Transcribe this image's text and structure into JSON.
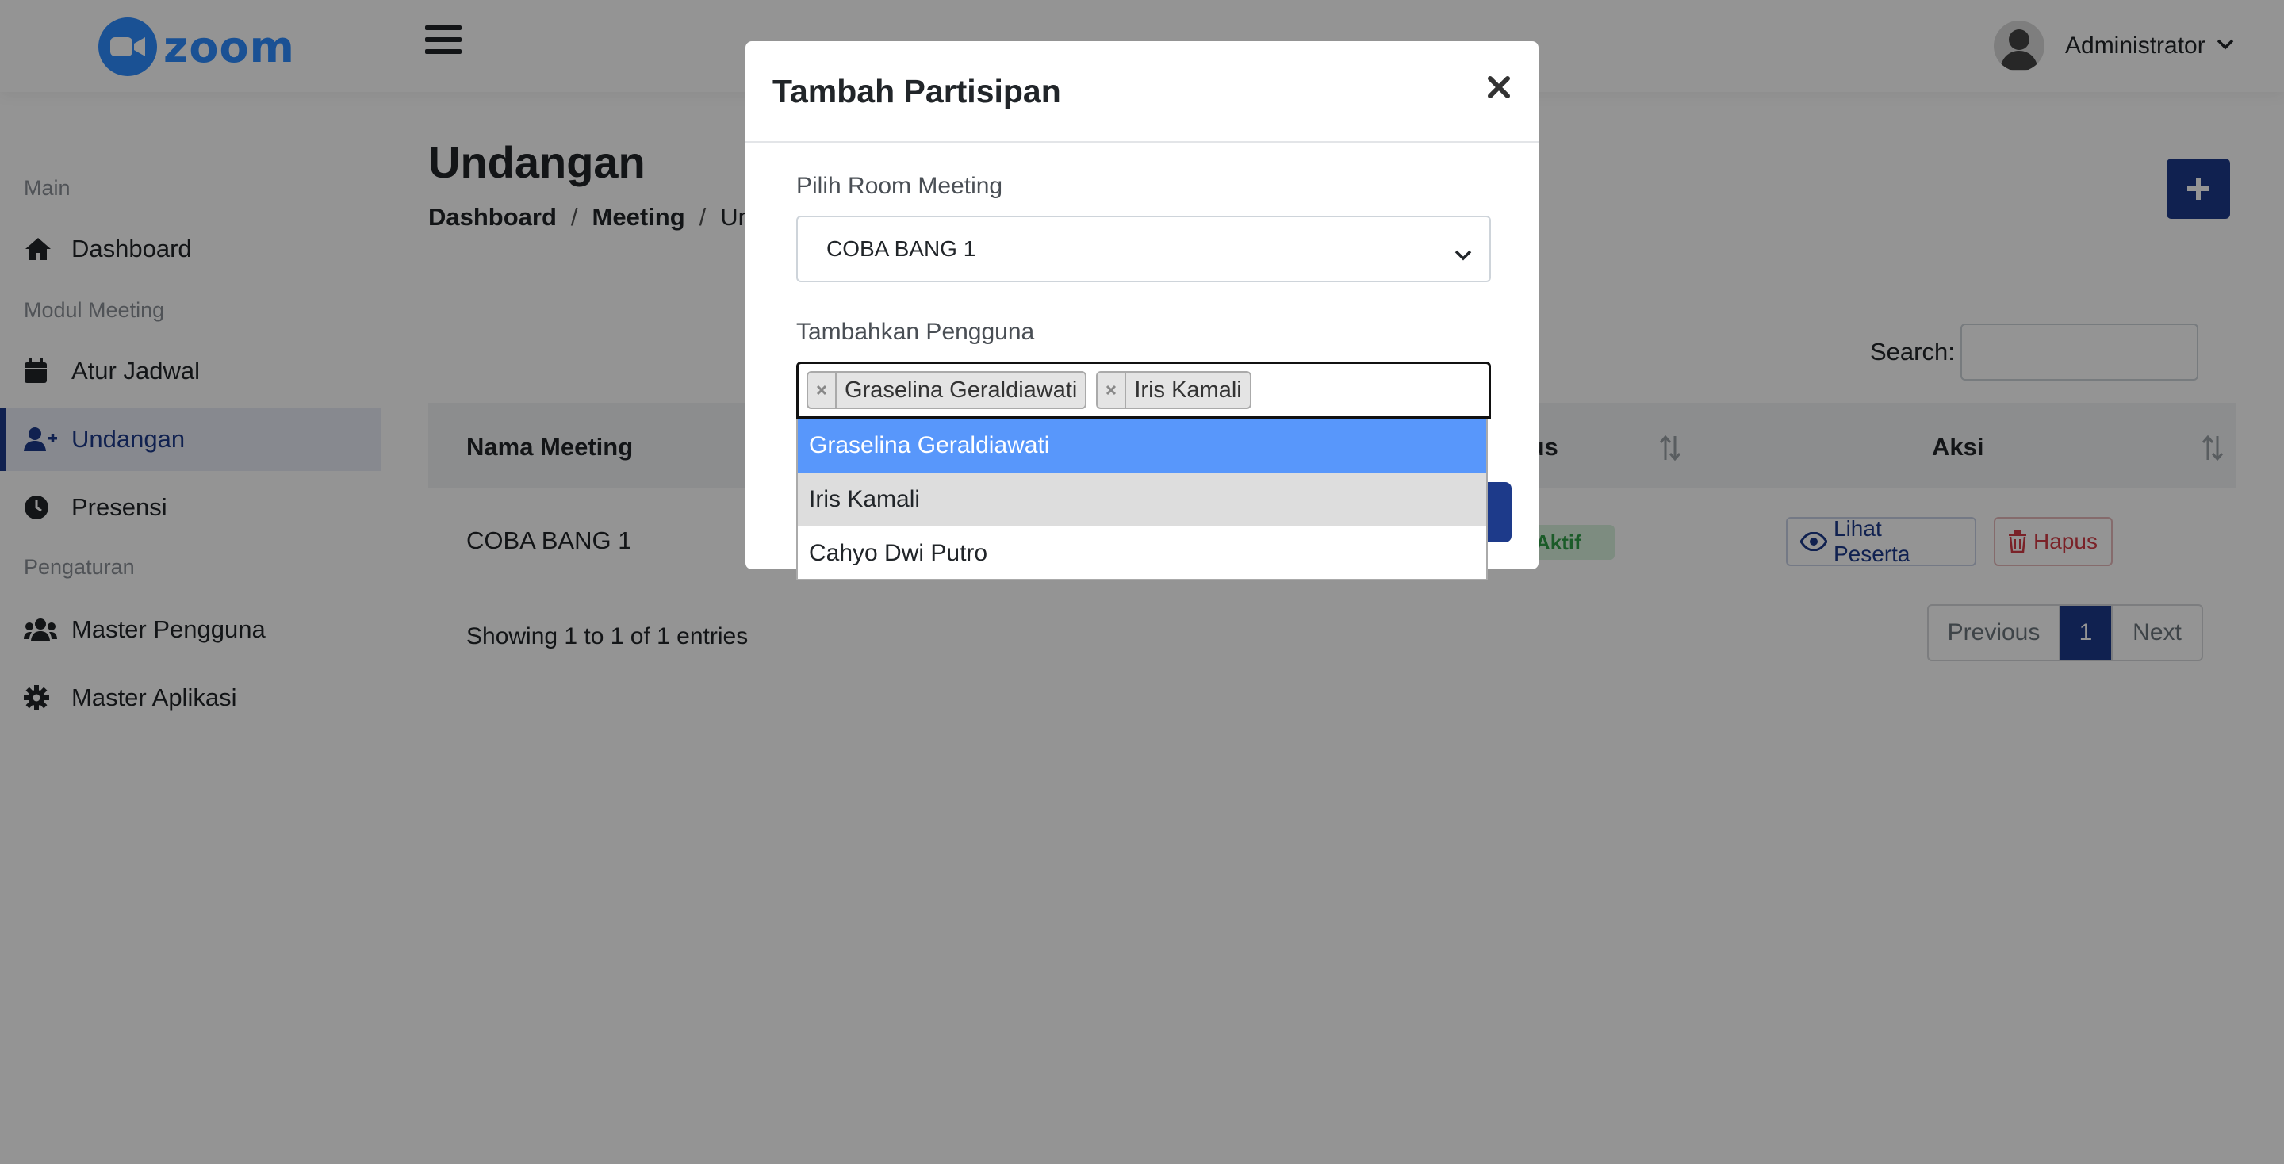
{
  "header": {
    "logo_text": "zoom",
    "user_name": "Administrator",
    "icons": {
      "logo": "zoom-camera-icon",
      "menu": "hamburger-icon",
      "avatar": "user-avatar-icon",
      "dropdown": "chevron-down-icon"
    }
  },
  "sidebar": {
    "sections": [
      "Main",
      "Modul Meeting",
      "Pengaturan"
    ],
    "items": [
      {
        "label": "Dashboard",
        "icon": "home-icon"
      },
      {
        "label": "Atur Jadwal",
        "icon": "calendar-icon"
      },
      {
        "label": "Undangan",
        "icon": "user-plus-icon",
        "active": true
      },
      {
        "label": "Presensi",
        "icon": "clock-icon"
      },
      {
        "label": "Master Pengguna",
        "icon": "users-icon"
      },
      {
        "label": "Master Aplikasi",
        "icon": "gear-icon"
      }
    ]
  },
  "page": {
    "title": "Undangan",
    "breadcrumb": [
      "Dashboard",
      "Meeting",
      "Undangan"
    ],
    "breadcrumb_sep": "/"
  },
  "table": {
    "search_label": "Search:",
    "columns": [
      "Nama Meeting",
      "Status",
      "Aksi"
    ],
    "rows": [
      {
        "nama_meeting": "COBA BANG 1",
        "status": "Aktif",
        "lihat": "Lihat Peserta",
        "hapus": "Hapus"
      }
    ],
    "info": "Showing 1 to 1 of 1 entries",
    "pagination": {
      "previous": "Previous",
      "current": "1",
      "next": "Next"
    }
  },
  "modal": {
    "title": "Tambah Partisipan",
    "close": "×",
    "room_label": "Pilih Room Meeting",
    "room_value": "COBA BANG 1",
    "user_label": "Tambahkan Pengguna",
    "selected_tags": [
      "Graselina Geraldiawati",
      "Iris Kamali"
    ],
    "tag_remove": "×",
    "options": [
      "Graselina Geraldiawati",
      "Iris Kamali",
      "Cahyo Dwi Putro"
    ]
  },
  "colors": {
    "brand": "#1d3a8a",
    "zoom_blue": "#2d8cff",
    "option_highlight": "#5897fb",
    "status_green": "#2f9e48",
    "danger": "#d23b45"
  }
}
